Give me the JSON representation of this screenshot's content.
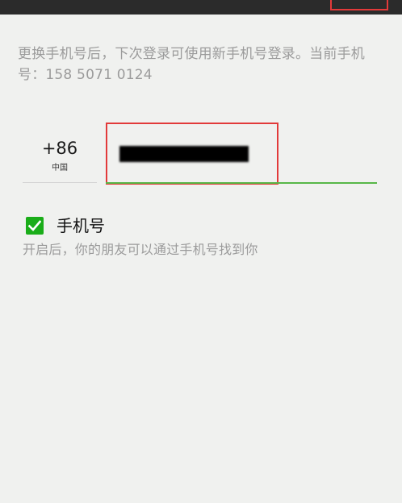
{
  "notice": {
    "text": "更换手机号后，下次登录可使用新手机号登录。当前手机号：158 5071 0124"
  },
  "country": {
    "code": "+86",
    "name": "中国"
  },
  "phone_field": {
    "value_redacted": true
  },
  "discoverable": {
    "checked": true,
    "label": "手机号",
    "hint": "开启后，你的朋友可以通过手机号找到你"
  },
  "colors": {
    "accent_green": "#1aad19",
    "annotation_red": "#e23a3a",
    "background": "#f0f1ef"
  },
  "icons": {
    "checkbox": "check-icon"
  }
}
